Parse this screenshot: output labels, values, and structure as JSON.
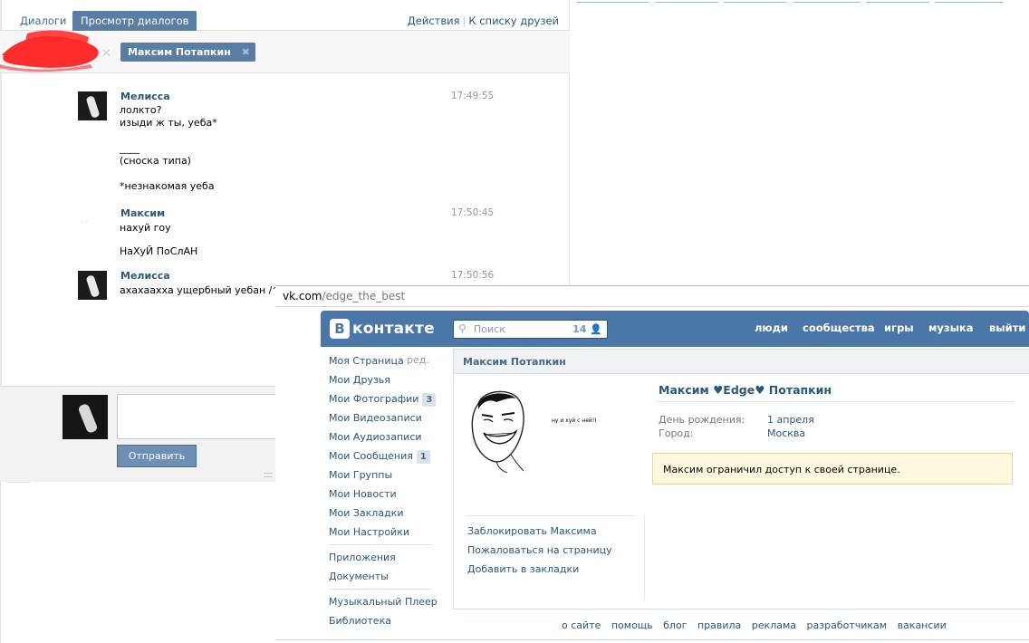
{
  "dialogs": {
    "tabs": [
      {
        "label": "Диалоги"
      },
      {
        "label": "Просмотр диалогов"
      }
    ],
    "actions_label": "Действия",
    "friends_link": "К списку друзей",
    "recipient_chip": "Максим Потапкин",
    "messages": [
      {
        "author": "Мелисса",
        "time": "17:49:55",
        "lines": [
          "лолкто?",
          "изыди ж ты, уеба*",
          "",
          "____",
          "(сноска типа)",
          "",
          "*незнакомая уеба"
        ]
      },
      {
        "author": "Максим",
        "time": "17:50:45",
        "lines": [
          "нахуй гоу",
          "",
          "НаХуЙ ПоСлАН"
        ]
      },
      {
        "author": "Мелисса",
        "time": "17:50:56",
        "lines": [
          "ахахаахха ущербный уебан /^о"
        ]
      }
    ],
    "send_button": "Отправить"
  },
  "browser": {
    "url_domain": "vk.com",
    "url_path": "/edge_the_best"
  },
  "vk": {
    "logo_letter": "В",
    "logo_text": "контакте",
    "search_placeholder": "Поиск",
    "search_count": "14",
    "nav": [
      "люди",
      "сообщества",
      "игры",
      "музыка",
      "выйти"
    ],
    "sidebar": [
      {
        "label": "Моя Страница",
        "extra": "ред."
      },
      {
        "label": "Мои Друзья"
      },
      {
        "label": "Мои Фотографии",
        "badge": "3"
      },
      {
        "label": "Мои Видеозаписи"
      },
      {
        "label": "Мои Аудиозаписи"
      },
      {
        "label": "Мои Сообщения",
        "badge": "1"
      },
      {
        "label": "Мои Группы"
      },
      {
        "label": "Мои Новости"
      },
      {
        "label": "Мои Закладки"
      },
      {
        "label": "Мои Настройки"
      },
      {
        "label": "Приложения"
      },
      {
        "label": "Документы"
      },
      {
        "label": "Музыкальный Плеер"
      },
      {
        "label": "Библиотека"
      }
    ],
    "profile": {
      "box_title": "Максим Потапкин",
      "full_name": "Максим ♥Edge♥ Потапкин",
      "birthday_label": "День рождения:",
      "birthday_value": "1 апреля",
      "city_label": "Город:",
      "city_value": "Москва",
      "notice": "Максим ограничил доступ к своей странице.",
      "meme_caption": "ну и хуй с ней!)",
      "actions": [
        "Заблокировать Максима",
        "Пожаловаться на страницу",
        "Добавить в закладки"
      ]
    },
    "footer": [
      "о сайте",
      "помощь",
      "блог",
      "правила",
      "реклама",
      "разработчикам",
      "вакансии"
    ]
  },
  "colors": {
    "vk_blue": "#4a76a8",
    "link": "#2b587a",
    "tab_active": "#597da3",
    "redaction": "#ff1a1a",
    "notice_bg": "#fff9e0"
  }
}
